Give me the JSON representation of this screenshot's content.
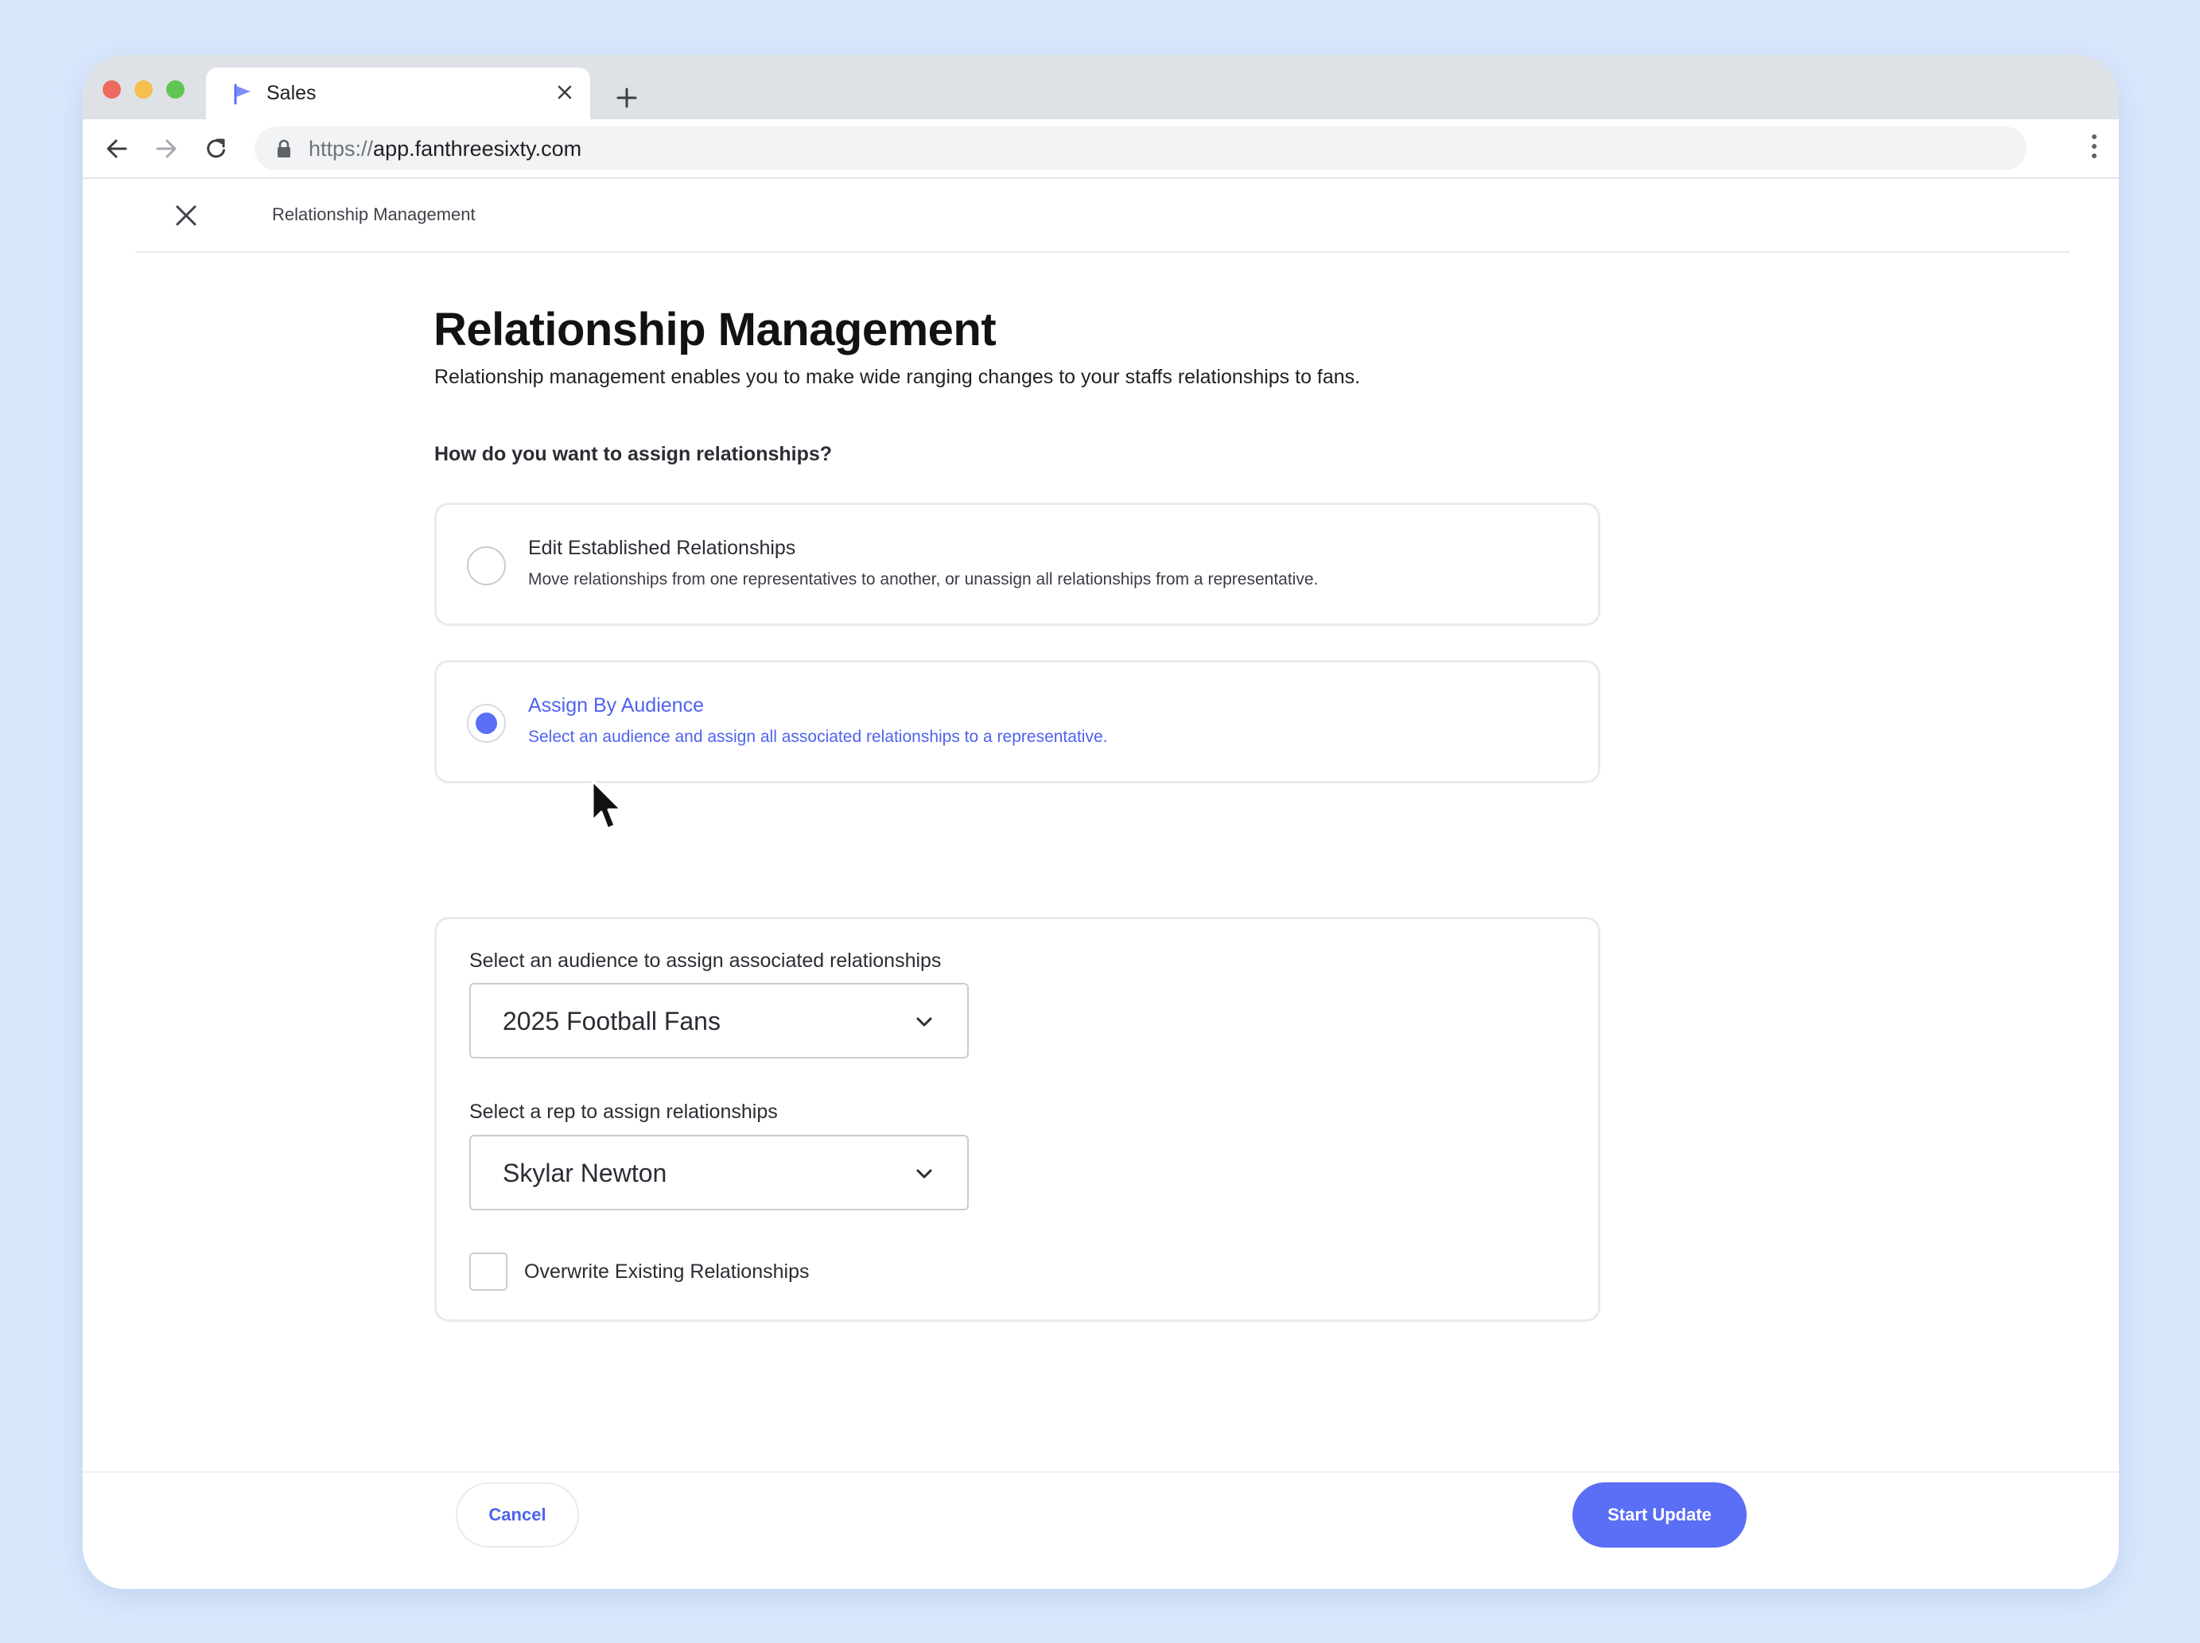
{
  "browser": {
    "tab_title": "Sales",
    "url_protocol": "https://",
    "url_host": "app.fanthreesixty.com"
  },
  "header": {
    "title": "Relationship Management"
  },
  "page": {
    "title": "Relationship Management",
    "description": "Relationship management enables you to make wide ranging changes to your staffs relationships to fans.",
    "question": "How do you want to assign relationships?"
  },
  "options": [
    {
      "title": "Edit Established Relationships",
      "subtitle": "Move relationships from one representatives to another, or unassign all relationships from a representative.",
      "selected": false
    },
    {
      "title": "Assign By Audience",
      "subtitle": "Select an audience and assign all associated relationships to a representative.",
      "selected": true
    }
  ],
  "assign": {
    "audience_label": "Select an audience to assign associated relationships",
    "audience_value": "2025 Football Fans",
    "rep_label": "Select a rep to assign relationships",
    "rep_value": "Skylar Newton",
    "overwrite_label": "Overwrite Existing Relationships",
    "overwrite_checked": false
  },
  "footer": {
    "cancel_label": "Cancel",
    "start_label": "Start Update"
  },
  "colors": {
    "accent": "#5a6ef6",
    "accent_text": "#4f63ee",
    "background": "#dae8fd"
  }
}
